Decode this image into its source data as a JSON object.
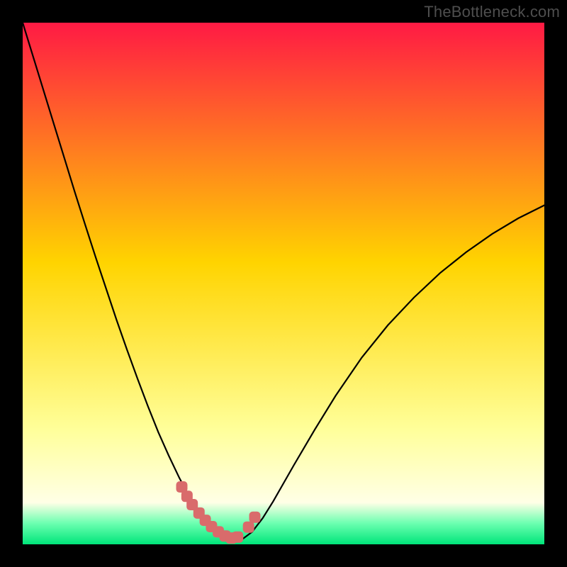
{
  "attribution": "TheBottleneck.com",
  "colors": {
    "bg_black": "#000000",
    "grad_top": "#ff1a44",
    "grad_mid": "#ffd400",
    "grad_paleyellow": "#ffff9a",
    "grad_green_light": "#6bffb0",
    "grad_green": "#00e57a",
    "curve": "#000000",
    "marker": "#d96b6b",
    "attribution_text": "#4e4e4e"
  },
  "chart_data": {
    "type": "line",
    "title": "",
    "xlabel": "",
    "ylabel": "",
    "xlim": [
      0,
      100
    ],
    "ylim": [
      0,
      100
    ],
    "grid": false,
    "legend": false,
    "series": [
      {
        "name": "bottleneck-curve",
        "x": [
          0,
          2,
          4,
          6,
          8,
          10,
          12,
          14,
          16,
          18,
          20,
          22,
          24,
          26,
          28,
          30,
          32,
          33,
          34,
          35,
          36,
          37,
          38,
          39,
          40,
          41,
          42,
          44,
          46,
          48,
          52,
          56,
          60,
          65,
          70,
          75,
          80,
          85,
          90,
          95,
          100
        ],
        "y": [
          100,
          93.5,
          87,
          80.5,
          74,
          67.5,
          61.2,
          55,
          49,
          43,
          37.3,
          31.8,
          26.5,
          21.5,
          17,
          12.8,
          9,
          7.4,
          5.9,
          4.6,
          3.5,
          2.6,
          1.9,
          1.3,
          0.9,
          0.7,
          0.9,
          2.4,
          5,
          8.2,
          15.2,
          22,
          28.5,
          35.8,
          42,
          47.3,
          52,
          56,
          59.5,
          62.5,
          65
        ]
      }
    ],
    "markers": {
      "name": "highlighted-points",
      "shape": "rounded-square",
      "x": [
        30.5,
        31.5,
        32.5,
        33.8,
        35,
        36.2,
        37.5,
        38.8,
        40,
        41.2,
        43.3,
        44.5
      ],
      "y": [
        11.0,
        9.2,
        7.6,
        6.0,
        4.6,
        3.4,
        2.4,
        1.6,
        1.2,
        1.4,
        3.3,
        5.2
      ]
    }
  }
}
